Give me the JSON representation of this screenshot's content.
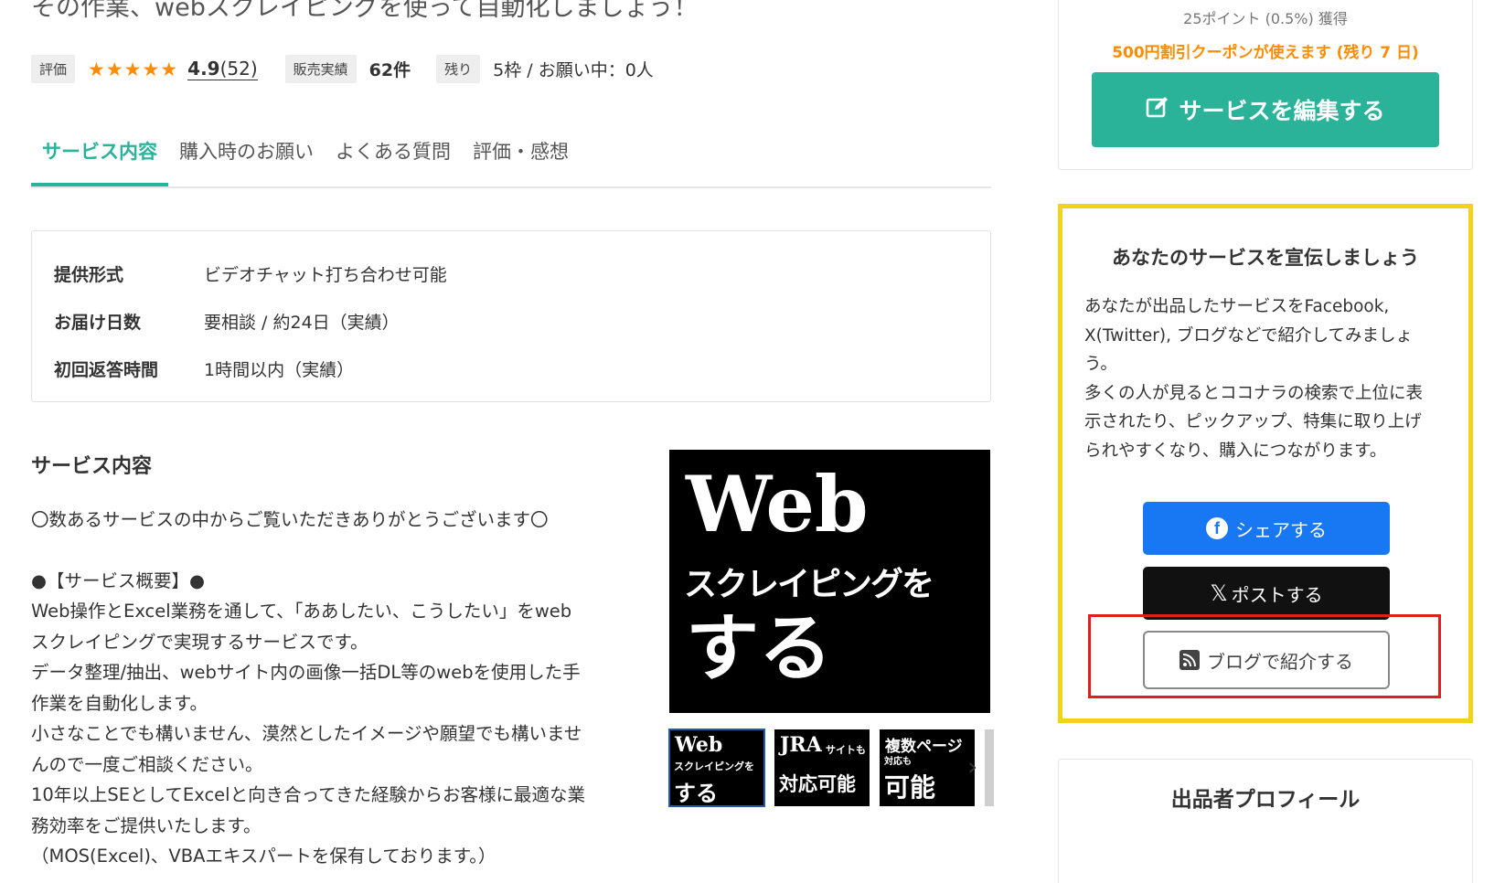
{
  "service": {
    "headline": "その作業、webスクレイピングを使って自動化しましょう！",
    "meta": {
      "rating_tag": "評価",
      "stars": "★★★★★",
      "rating": "4.9",
      "rating_count": "(52)",
      "sales_tag": "販売実績",
      "sales_value": "62件",
      "remaining_tag": "残り",
      "remaining_value": "5枠 / お願い中：0人"
    }
  },
  "tabs": [
    "サービス内容",
    "購入時のお願い",
    "よくある質問",
    "評価・感想"
  ],
  "spec": [
    {
      "key": "提供形式",
      "value": "ビデオチャット打ち合わせ可能"
    },
    {
      "key": "お届け日数",
      "value": "要相談 / 約24日（実績）"
    },
    {
      "key": "初回返答時間",
      "value": "1時間以内（実績）"
    }
  ],
  "description": {
    "title": "サービス内容",
    "lines": [
      "〇数あるサービスの中からご覧いただきありがとうございます〇",
      "",
      "●【サービス概要】●",
      "Web操作とExcel業務を通して、「ああしたい、こうしたい」をweb",
      "スクレイピングで実現するサービスです。",
      "データ整理/抽出、webサイト内の画像一括DL等のwebを使用した手",
      "作業を自動化します。",
      "小さなことでも構いません、漠然としたイメージや願望でも構いませ",
      "んので一度ご相談ください。",
      "10年以上SEとしてExcelと向き合ってきた経験からお客様に最適な業",
      "務効率をご提供いたします。",
      "（MOS(Excel)、VBAエキスパートを保有しております。）"
    ]
  },
  "hero_image": {
    "line1": "Web",
    "line2": "スクレイピングを",
    "line3": "する"
  },
  "thumbnails": [
    {
      "t1": "Web",
      "t2": "スクレイピングを",
      "t3": "する"
    },
    {
      "t1": "JRA",
      "t2": "サイトも",
      "t3": "対応可能"
    },
    {
      "t1": "複数ページ",
      "t2": "対応も",
      "t3": "可能"
    }
  ],
  "thumb_next": "›",
  "buybox": {
    "points": "25ポイント (0.5%) 獲得",
    "coupon": "500円割引クーポンが使えます (残り 7 日)",
    "edit_button": "サービスを編集する"
  },
  "promo": {
    "title": "あなたのサービスを宣伝しましょう",
    "text_lines": [
      "あなたが出品したサービスをFacebook,",
      "X(Twitter), ブログなどで紹介してみましょ",
      "う。",
      "多くの人が見るとココナラの検索で上位に表",
      "示されたり、ピックアップ、特集に取り上げ",
      "られやすくなり、購入につながります。"
    ],
    "facebook_button": "シェアする",
    "x_button": "ポストする",
    "blog_button": "ブログで紹介する"
  },
  "profile": {
    "title": "出品者プロフィール"
  },
  "colors": {
    "accent_green": "#2bb39a",
    "star_orange": "#ff8c00",
    "promo_border_yellow": "#f5d21a",
    "highlight_red": "#e02020",
    "facebook_blue": "#1877f2"
  },
  "icons": {
    "edit": "pencil-square-icon",
    "facebook": "facebook-icon",
    "x": "x-logo-icon",
    "blog": "rss-icon",
    "next": "chevron-right-icon"
  }
}
